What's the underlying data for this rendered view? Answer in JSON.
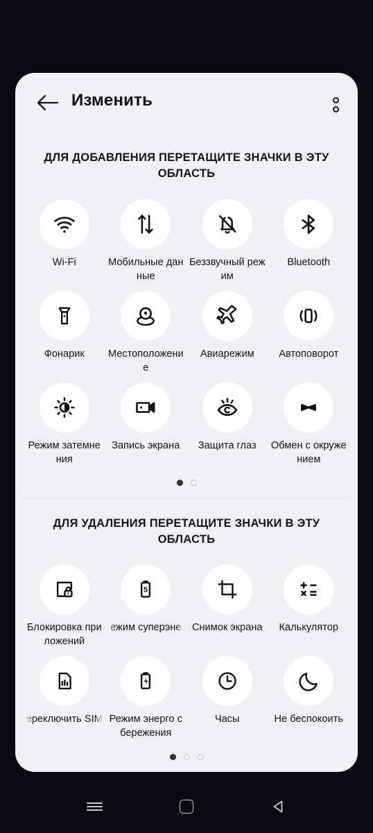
{
  "statusbar": {
    "background_color": "#090911"
  },
  "card": {
    "background_color": "#f0f1f4"
  },
  "header": {
    "title": "Изменить",
    "back_icon": "arrow-left-icon",
    "overflow_icon": "more-vertical-icon"
  },
  "add_section": {
    "title": "ДЛЯ ДОБАВЛЕНИЯ ПЕРЕТАЩИТЕ ЗНАЧКИ В ЭТУ ОБЛАСТЬ",
    "tiles": [
      {
        "label": "Wi-Fi",
        "icon": "wifi-icon",
        "clipped": false
      },
      {
        "label": "Мобильные данные",
        "icon": "mobile-data-icon",
        "clipped": false
      },
      {
        "label": "Беззвучный режим",
        "icon": "bell-off-icon",
        "clipped": false
      },
      {
        "label": "Bluetooth",
        "icon": "bluetooth-icon",
        "clipped": false
      },
      {
        "label": "Фонарик",
        "icon": "flashlight-icon",
        "clipped": false
      },
      {
        "label": "Местоположение",
        "icon": "location-pin-icon",
        "clipped": false
      },
      {
        "label": "Авиарежим",
        "icon": "airplane-icon",
        "clipped": false
      },
      {
        "label": "Автоповорот",
        "icon": "auto-rotate-icon",
        "clipped": false
      },
      {
        "label": "Режим затемнения",
        "icon": "brightness-dim-icon",
        "clipped": false
      },
      {
        "label": "Запись экрана",
        "icon": "screen-record-icon",
        "clipped": false
      },
      {
        "label": "Защита глаз",
        "icon": "eye-comfort-icon",
        "clipped": false
      },
      {
        "label": "Обмен с окружением",
        "icon": "nearby-share-icon",
        "clipped": false
      }
    ],
    "page_dots": {
      "count": 2,
      "active_index": 0
    }
  },
  "remove_section": {
    "title": "ДЛЯ УДАЛЕНИЯ ПЕРЕТАЩИТЕ ЗНАЧКИ В ЭТУ ОБЛАСТЬ",
    "tiles": [
      {
        "label": "Блокировка приложений",
        "icon": "app-lock-icon",
        "clipped": false
      },
      {
        "label": "ежим суперэне",
        "icon": "battery-saver-icon",
        "clipped": true
      },
      {
        "label": "Снимок экрана",
        "icon": "screenshot-crop-icon",
        "clipped": false
      },
      {
        "label": "Калькулятор",
        "icon": "calculator-icon",
        "clipped": false
      },
      {
        "label": "ереключить SIM",
        "icon": "sim-card-icon",
        "clipped": true
      },
      {
        "label": "Режим энерго сбережения",
        "icon": "battery-charge-icon",
        "clipped": false
      },
      {
        "label": "Часы",
        "icon": "clock-icon",
        "clipped": false
      },
      {
        "label": "Не беспокоить",
        "icon": "moon-icon",
        "clipped": false
      }
    ],
    "page_dots": {
      "count": 3,
      "active_index": 0
    }
  },
  "navbar": {
    "buttons": [
      {
        "name": "recents",
        "icon": "menu-lines-icon"
      },
      {
        "name": "home",
        "icon": "home-square-icon"
      },
      {
        "name": "back",
        "icon": "back-triangle-icon"
      }
    ]
  }
}
